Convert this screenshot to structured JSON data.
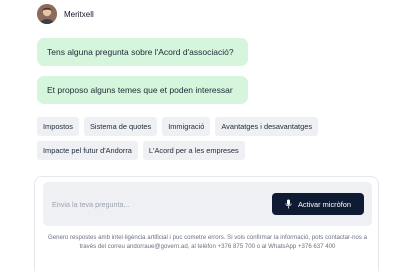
{
  "assistant": {
    "name": "Meritxell"
  },
  "messages": [
    "Tens alguna pregunta sobre l'Acord d'associació?",
    "Et proposo alguns temes que et poden interessar"
  ],
  "topics": [
    [
      "Impostos",
      "Sistema de quotes",
      "Immigració",
      "Avantatges i desavantatges"
    ],
    [
      "Impacte pel futur d'Andorra",
      "L'Acord per a les empreses"
    ]
  ],
  "input": {
    "placeholder": "Envia la teva pregunta...",
    "value": ""
  },
  "mic_button": {
    "label": "Activar micròfon"
  },
  "disclaimer": "Genero respostes amb intel·ligència artificial i puc cometre errors. Si vols confirmar la informació, pots contactar-nos a través del correu andorraue@govern.ad, al telèfon +376 875 700 o al WhatsApp +376 637 400",
  "colors": {
    "bubble_bg": "#d5f5dc",
    "chip_bg": "#eef0f3",
    "button_bg": "#0f1a33",
    "input_bg": "#eef0f4"
  },
  "icons": [
    "avatar-photo",
    "microphone-icon"
  ]
}
